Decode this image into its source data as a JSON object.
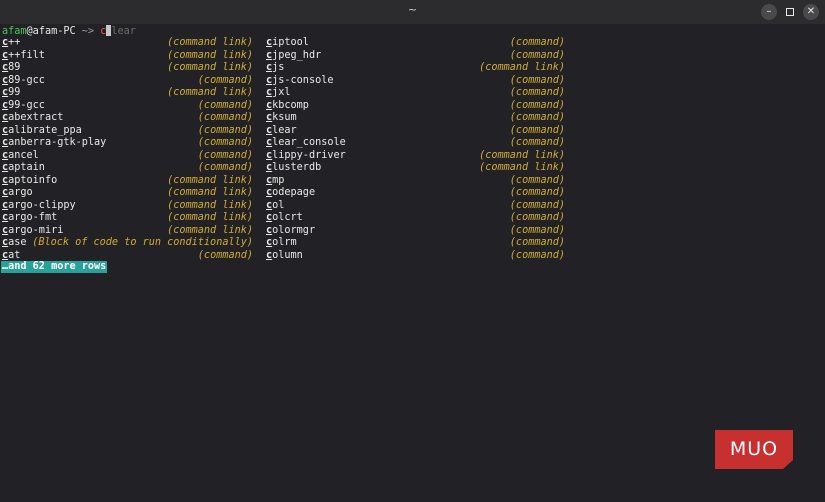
{
  "window": {
    "title": "~",
    "buttons": {
      "minimize": "–",
      "close": "✕"
    }
  },
  "prompt": {
    "user": "afam",
    "host": "@afam-PC",
    "arrow": " ~> ",
    "typed": "c",
    "suggestion": "lear"
  },
  "completions": {
    "left": [
      {
        "name": "c++",
        "desc": "(command link)"
      },
      {
        "name": "c++filt",
        "desc": "(command link)"
      },
      {
        "name": "c89",
        "desc": "(command link)"
      },
      {
        "name": "c89-gcc",
        "desc": "(command)"
      },
      {
        "name": "c99",
        "desc": "(command link)"
      },
      {
        "name": "c99-gcc",
        "desc": "(command)"
      },
      {
        "name": "cabextract",
        "desc": "(command)"
      },
      {
        "name": "calibrate_ppa",
        "desc": "(command)"
      },
      {
        "name": "canberra-gtk-play",
        "desc": "(command)"
      },
      {
        "name": "cancel",
        "desc": "(command)"
      },
      {
        "name": "captain",
        "desc": "(command)"
      },
      {
        "name": "captoinfo",
        "desc": "(command link)"
      },
      {
        "name": "cargo",
        "desc": "(command link)"
      },
      {
        "name": "cargo-clippy",
        "desc": "(command link)"
      },
      {
        "name": "cargo-fmt",
        "desc": "(command link)"
      },
      {
        "name": "cargo-miri",
        "desc": "(command link)"
      },
      {
        "name": "case",
        "desc": "(Block of code to run conditionally)"
      },
      {
        "name": "cat",
        "desc": "(command)"
      }
    ],
    "right": [
      {
        "name": "ciptool",
        "desc": "(command)"
      },
      {
        "name": "cjpeg_hdr",
        "desc": "(command)"
      },
      {
        "name": "cjs",
        "desc": "(command link)"
      },
      {
        "name": "cjs-console",
        "desc": "(command)"
      },
      {
        "name": "cjxl",
        "desc": "(command)"
      },
      {
        "name": "ckbcomp",
        "desc": "(command)"
      },
      {
        "name": "cksum",
        "desc": "(command)"
      },
      {
        "name": "clear",
        "desc": "(command)"
      },
      {
        "name": "clear_console",
        "desc": "(command)"
      },
      {
        "name": "clippy-driver",
        "desc": "(command link)"
      },
      {
        "name": "clusterdb",
        "desc": "(command link)"
      },
      {
        "name": "cmp",
        "desc": "(command)"
      },
      {
        "name": "codepage",
        "desc": "(command)"
      },
      {
        "name": "col",
        "desc": "(command)"
      },
      {
        "name": "colcrt",
        "desc": "(command)"
      },
      {
        "name": "colormgr",
        "desc": "(command)"
      },
      {
        "name": "colrm",
        "desc": "(command)"
      },
      {
        "name": "column",
        "desc": "(command)"
      }
    ],
    "more_rows": "…and 62 more rows"
  },
  "watermark": {
    "text": "MUO"
  },
  "colors": {
    "background": "#222226",
    "prompt_user": "#4fc452",
    "description": "#d2ad2e",
    "highlight": "#2aa198",
    "watermark": "#c8302f"
  }
}
